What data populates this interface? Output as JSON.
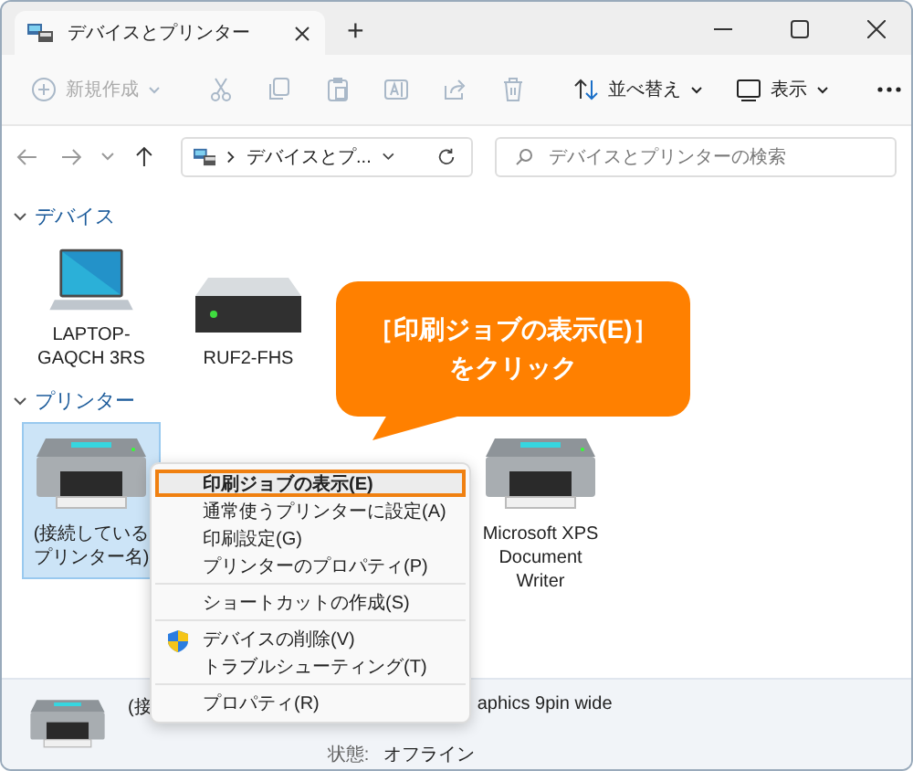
{
  "window": {
    "tab_title": "デバイスとプリンター",
    "new_tab": "+"
  },
  "toolbar": [
    {
      "kind": "new",
      "label": "新規作成",
      "disabled": true
    },
    {
      "kind": "cut",
      "disabled": true
    },
    {
      "kind": "copy",
      "disabled": true
    },
    {
      "kind": "paste",
      "disabled": true
    },
    {
      "kind": "rename",
      "disabled": true
    },
    {
      "kind": "share",
      "disabled": true
    },
    {
      "kind": "delete",
      "disabled": true
    },
    {
      "kind": "sort",
      "label": "並べ替え",
      "disabled": false
    },
    {
      "kind": "view",
      "label": "表示",
      "disabled": false
    },
    {
      "kind": "more",
      "disabled": false
    }
  ],
  "address": {
    "path": "デバイスとプ...",
    "search_placeholder": "デバイスとプリンターの検索"
  },
  "groups": [
    {
      "title": "デバイス",
      "expanded": true,
      "items": [
        {
          "kind": "laptop",
          "label": "LAPTOP-GAQCH 3RS",
          "selected": false
        },
        {
          "kind": "drive",
          "label": "RUF2-FHS",
          "selected": false
        }
      ]
    },
    {
      "title": "プリンター",
      "expanded": true,
      "items": [
        {
          "kind": "printer",
          "label": "(接続しているプリンター名)",
          "selected": true
        },
        {
          "kind": "printer",
          "label": "Microsoft XPS Document Writer",
          "selected": false
        }
      ]
    }
  ],
  "context_menu": [
    {
      "kind": "item",
      "label": "印刷ジョブの表示(E)",
      "default": true,
      "selected": true,
      "shield": false
    },
    {
      "kind": "item",
      "label": "通常使うプリンターに設定(A)",
      "default": false,
      "selected": false,
      "shield": false
    },
    {
      "kind": "item",
      "label": "印刷設定(G)",
      "default": false,
      "selected": false,
      "shield": false
    },
    {
      "kind": "item",
      "label": "プリンターのプロパティ(P)",
      "default": false,
      "selected": false,
      "shield": false
    },
    {
      "kind": "separator"
    },
    {
      "kind": "item",
      "label": "ショートカットの作成(S)",
      "default": false,
      "selected": false,
      "shield": false
    },
    {
      "kind": "separator"
    },
    {
      "kind": "item",
      "label": "デバイスの削除(V)",
      "default": false,
      "selected": false,
      "shield": true
    },
    {
      "kind": "item",
      "label": "トラブルシューティング(T)",
      "default": false,
      "selected": false,
      "shield": false
    },
    {
      "kind": "separator"
    },
    {
      "kind": "item",
      "label": "プロパティ(R)",
      "default": false,
      "selected": false,
      "shield": false
    }
  ],
  "callout": {
    "lines": [
      "［印刷ジョブの表示(E)］",
      "をクリック"
    ]
  },
  "details": {
    "name": "(接",
    "model": "aphics 9pin wide",
    "status_label": "状態:",
    "status": "オフライン"
  }
}
